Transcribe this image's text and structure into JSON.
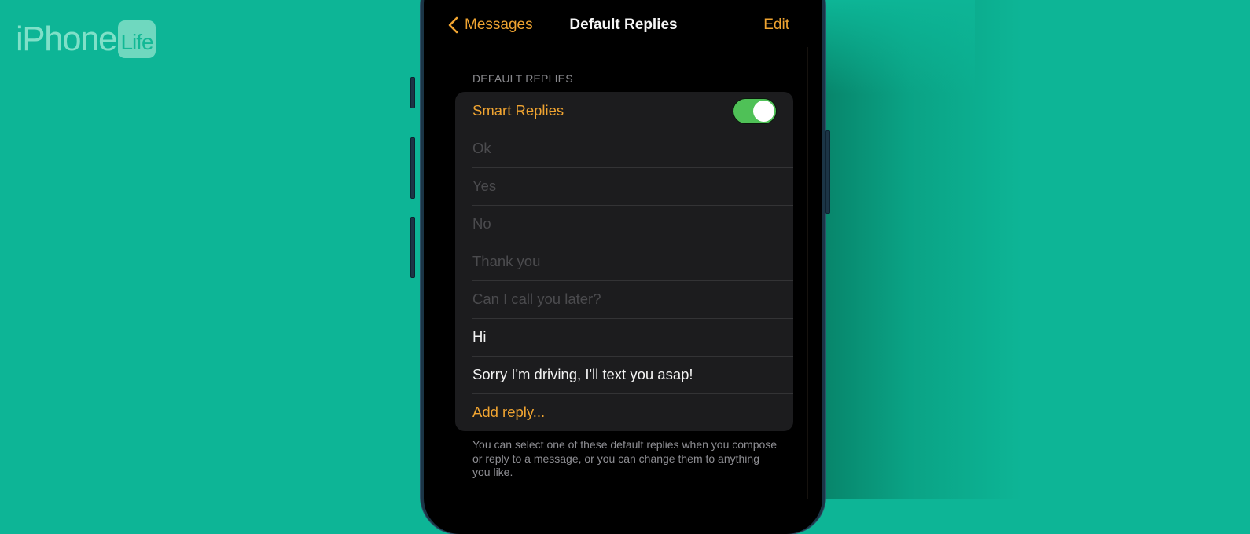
{
  "branding": {
    "logo_text": "iPhone",
    "logo_badge": "Life"
  },
  "nav": {
    "back_label": "Messages",
    "title": "Default Replies",
    "edit_label": "Edit"
  },
  "section": {
    "header": "DEFAULT REPLIES",
    "smart_replies_label": "Smart Replies",
    "smart_replies_enabled": true,
    "replies": [
      {
        "text": "Ok",
        "state": "disabled"
      },
      {
        "text": "Yes",
        "state": "disabled"
      },
      {
        "text": "No",
        "state": "disabled"
      },
      {
        "text": "Thank you",
        "state": "disabled"
      },
      {
        "text": "Can I call you later?",
        "state": "disabled"
      },
      {
        "text": "Hi",
        "state": "active"
      },
      {
        "text": "Sorry I'm driving, I'll text you asap!",
        "state": "active"
      }
    ],
    "add_reply_label": "Add reply...",
    "footer": "You can select one of these default replies when you compose or reply to a message, or you can change them to anything you like."
  },
  "colors": {
    "background": "#0db596",
    "accent": "#f0a431",
    "toggle_on": "#4fc157",
    "cell_bg": "#1c1c1e"
  }
}
